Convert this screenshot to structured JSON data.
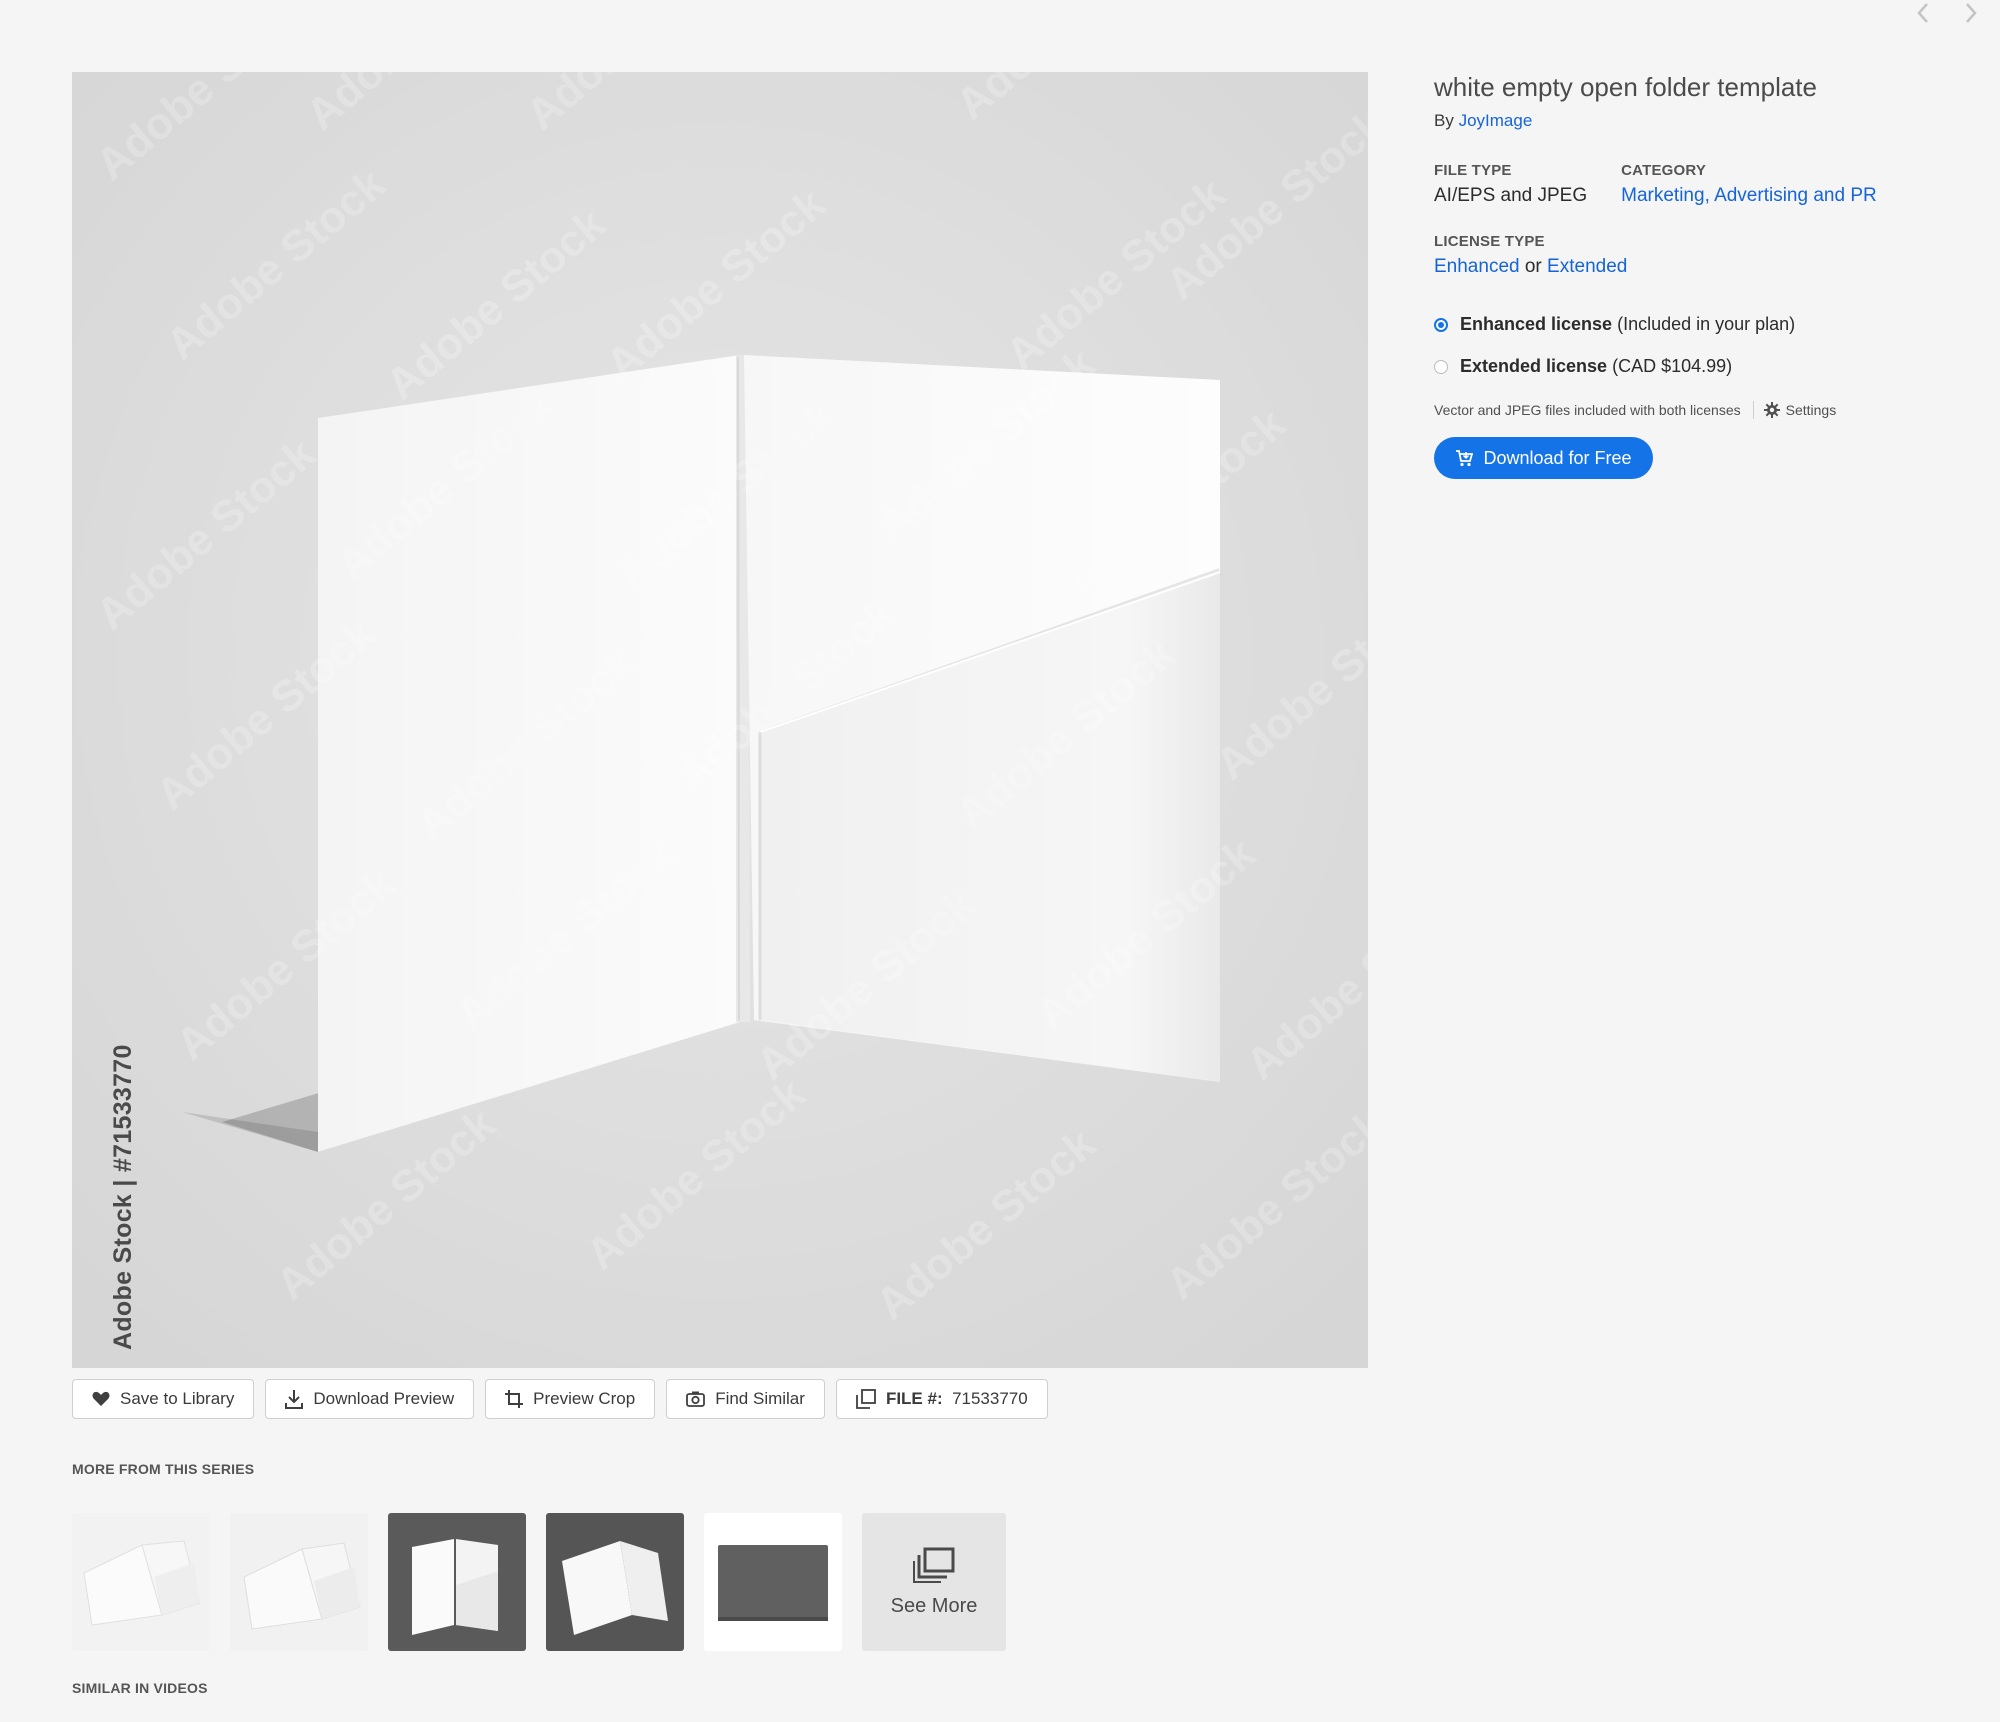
{
  "asset": {
    "title": "white empty open folder template",
    "by_label": "By",
    "author": "JoyImage",
    "watermark_text": "Adobe Stock",
    "side_label": "Adobe Stock | #71533770"
  },
  "meta": {
    "file_type_label": "FILE TYPE",
    "file_type": "AI/EPS and JPEG",
    "category_label": "CATEGORY",
    "category": "Marketing, Advertising and PR",
    "license_type_label": "LICENSE TYPE",
    "license_a": "Enhanced",
    "license_or": "or",
    "license_b": "Extended"
  },
  "licenses": [
    {
      "name": "Enhanced license",
      "detail": "(Included in your plan)",
      "selected": true
    },
    {
      "name": "Extended license",
      "detail": "(CAD $104.99)",
      "selected": false
    }
  ],
  "note": "Vector and JPEG files included with both licenses",
  "settings_label": "Settings",
  "download_button": "Download for Free",
  "toolbar": {
    "save": "Save to Library",
    "download_preview": "Download Preview",
    "preview_crop": "Preview Crop",
    "find_similar": "Find Similar",
    "file_key": "FILE #:",
    "file_number": "71533770"
  },
  "series": {
    "label": "MORE FROM THIS SERIES",
    "see_more": "See More"
  },
  "similar_videos_label": "SIMILAR IN VIDEOS",
  "colors": {
    "accent": "#1473e6",
    "link": "#1564d8",
    "background": "#f5f5f5"
  },
  "icons": [
    "chevron-left-icon",
    "chevron-right-icon",
    "heart-icon",
    "download-icon",
    "crop-icon",
    "camera-icon",
    "file-icon",
    "gear-icon",
    "cart-icon",
    "stack-icon"
  ]
}
